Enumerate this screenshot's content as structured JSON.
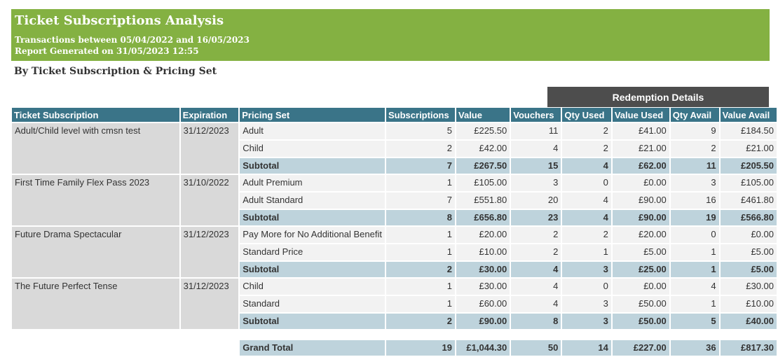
{
  "header": {
    "title": "Ticket Subscriptions Analysis",
    "transactions_line": "Transactions between 05/04/2022 and 16/05/2023",
    "generated_line": "Report Generated on 31/05/2023 12:55"
  },
  "section_title": "By Ticket Subscription & Pricing Set",
  "redemption_header": "Redemption Details",
  "columns": [
    "Ticket Subscription",
    "Expiration",
    "Pricing Set",
    "Subscriptions",
    "Value",
    "Vouchers",
    "Qty Used",
    "Value Used",
    "Qty Avail",
    "Value Avail"
  ],
  "groups": [
    {
      "subscription": "Adult/Child level with cmsn test",
      "expiration": "31/12/2023",
      "rows": [
        {
          "pricing_set": "Adult",
          "subscriptions": "5",
          "value": "£225.50",
          "vouchers": "11",
          "qty_used": "2",
          "value_used": "£41.00",
          "qty_avail": "9",
          "value_avail": "£184.50"
        },
        {
          "pricing_set": "Child",
          "subscriptions": "2",
          "value": "£42.00",
          "vouchers": "4",
          "qty_used": "2",
          "value_used": "£21.00",
          "qty_avail": "2",
          "value_avail": "£21.00"
        }
      ],
      "subtotal": {
        "label": "Subtotal",
        "subscriptions": "7",
        "value": "£267.50",
        "vouchers": "15",
        "qty_used": "4",
        "value_used": "£62.00",
        "qty_avail": "11",
        "value_avail": "£205.50"
      }
    },
    {
      "subscription": "First Time Family Flex Pass 2023",
      "expiration": "31/10/2022",
      "rows": [
        {
          "pricing_set": "Adult Premium",
          "subscriptions": "1",
          "value": "£105.00",
          "vouchers": "3",
          "qty_used": "0",
          "value_used": "£0.00",
          "qty_avail": "3",
          "value_avail": "£105.00"
        },
        {
          "pricing_set": "Adult Standard",
          "subscriptions": "7",
          "value": "£551.80",
          "vouchers": "20",
          "qty_used": "4",
          "value_used": "£90.00",
          "qty_avail": "16",
          "value_avail": "£461.80"
        }
      ],
      "subtotal": {
        "label": "Subtotal",
        "subscriptions": "8",
        "value": "£656.80",
        "vouchers": "23",
        "qty_used": "4",
        "value_used": "£90.00",
        "qty_avail": "19",
        "value_avail": "£566.80"
      }
    },
    {
      "subscription": "Future Drama Spectacular",
      "expiration": "31/12/2023",
      "rows": [
        {
          "pricing_set": "Pay More for No Additional Benefit",
          "subscriptions": "1",
          "value": "£20.00",
          "vouchers": "2",
          "qty_used": "2",
          "value_used": "£20.00",
          "qty_avail": "0",
          "value_avail": "£0.00"
        },
        {
          "pricing_set": "Standard Price",
          "subscriptions": "1",
          "value": "£10.00",
          "vouchers": "2",
          "qty_used": "1",
          "value_used": "£5.00",
          "qty_avail": "1",
          "value_avail": "£5.00"
        }
      ],
      "subtotal": {
        "label": "Subtotal",
        "subscriptions": "2",
        "value": "£30.00",
        "vouchers": "4",
        "qty_used": "3",
        "value_used": "£25.00",
        "qty_avail": "1",
        "value_avail": "£5.00"
      }
    },
    {
      "subscription": "The Future Perfect Tense",
      "expiration": "31/12/2023",
      "rows": [
        {
          "pricing_set": "Child",
          "subscriptions": "1",
          "value": "£30.00",
          "vouchers": "4",
          "qty_used": "0",
          "value_used": "£0.00",
          "qty_avail": "4",
          "value_avail": "£30.00"
        },
        {
          "pricing_set": "Standard",
          "subscriptions": "1",
          "value": "£60.00",
          "vouchers": "4",
          "qty_used": "3",
          "value_used": "£50.00",
          "qty_avail": "1",
          "value_avail": "£10.00"
        }
      ],
      "subtotal": {
        "label": "Subtotal",
        "subscriptions": "2",
        "value": "£90.00",
        "vouchers": "8",
        "qty_used": "3",
        "value_used": "£50.00",
        "qty_avail": "5",
        "value_avail": "£40.00"
      }
    }
  ],
  "grand_total": {
    "label": "Grand Total",
    "subscriptions": "19",
    "value": "£1,044.30",
    "vouchers": "50",
    "qty_used": "14",
    "value_used": "£227.00",
    "qty_avail": "36",
    "value_avail": "£817.30"
  }
}
